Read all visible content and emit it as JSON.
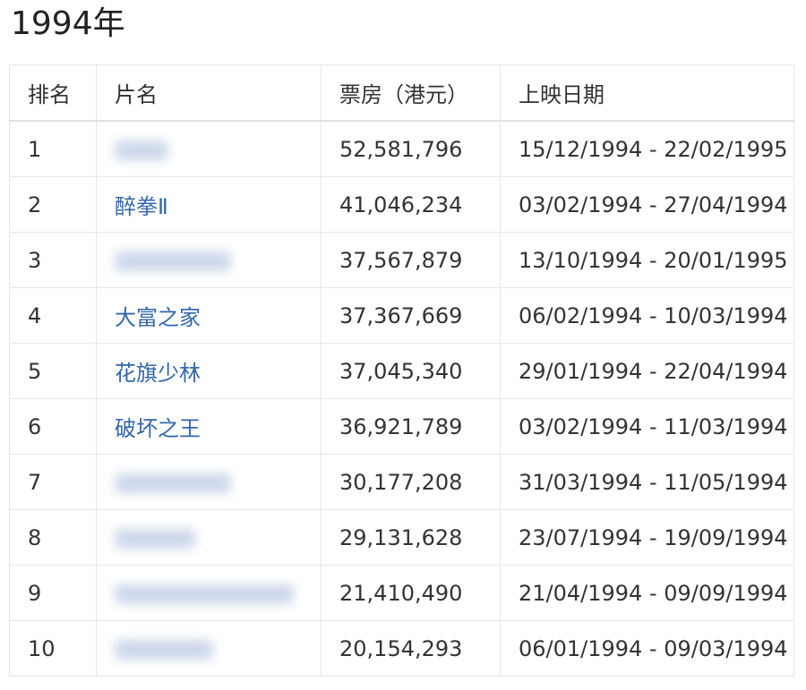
{
  "heading": "1994年",
  "columns": [
    "排名",
    "片名",
    "票房（港元）",
    "上映日期"
  ],
  "rows": [
    {
      "rank": "1",
      "title": "",
      "blurred": true,
      "box_office": "52,581,796",
      "dates": "15/12/1994 - 22/02/1995"
    },
    {
      "rank": "2",
      "title": "醉拳Ⅱ",
      "blurred": false,
      "box_office": "41,046,234",
      "dates": "03/02/1994 - 27/04/1994"
    },
    {
      "rank": "3",
      "title": "",
      "blurred": true,
      "box_office": "37,567,879",
      "dates": "13/10/1994 - 20/01/1995"
    },
    {
      "rank": "4",
      "title": "大富之家",
      "blurred": false,
      "box_office": "37,367,669",
      "dates": "06/02/1994 - 10/03/1994"
    },
    {
      "rank": "5",
      "title": "花旗少林",
      "blurred": false,
      "box_office": "37,045,340",
      "dates": "29/01/1994 - 22/04/1994"
    },
    {
      "rank": "6",
      "title": "破坏之王",
      "blurred": false,
      "box_office": "36,921,789",
      "dates": "03/02/1994 - 11/03/1994"
    },
    {
      "rank": "7",
      "title": "",
      "blurred": true,
      "box_office": "30,177,208",
      "dates": "31/03/1994 - 11/05/1994"
    },
    {
      "rank": "8",
      "title": "",
      "blurred": true,
      "box_office": "29,131,628",
      "dates": "23/07/1994 - 19/09/1994"
    },
    {
      "rank": "9",
      "title": "",
      "blurred": true,
      "box_office": "21,410,490",
      "dates": "21/04/1994 - 09/09/1994"
    },
    {
      "rank": "10",
      "title": "",
      "blurred": true,
      "box_office": "20,154,293",
      "dates": "06/01/1994 - 09/03/1994"
    }
  ],
  "colors": {
    "link": "#3366aa",
    "border": "#e6e6e6",
    "text": "#333333"
  }
}
